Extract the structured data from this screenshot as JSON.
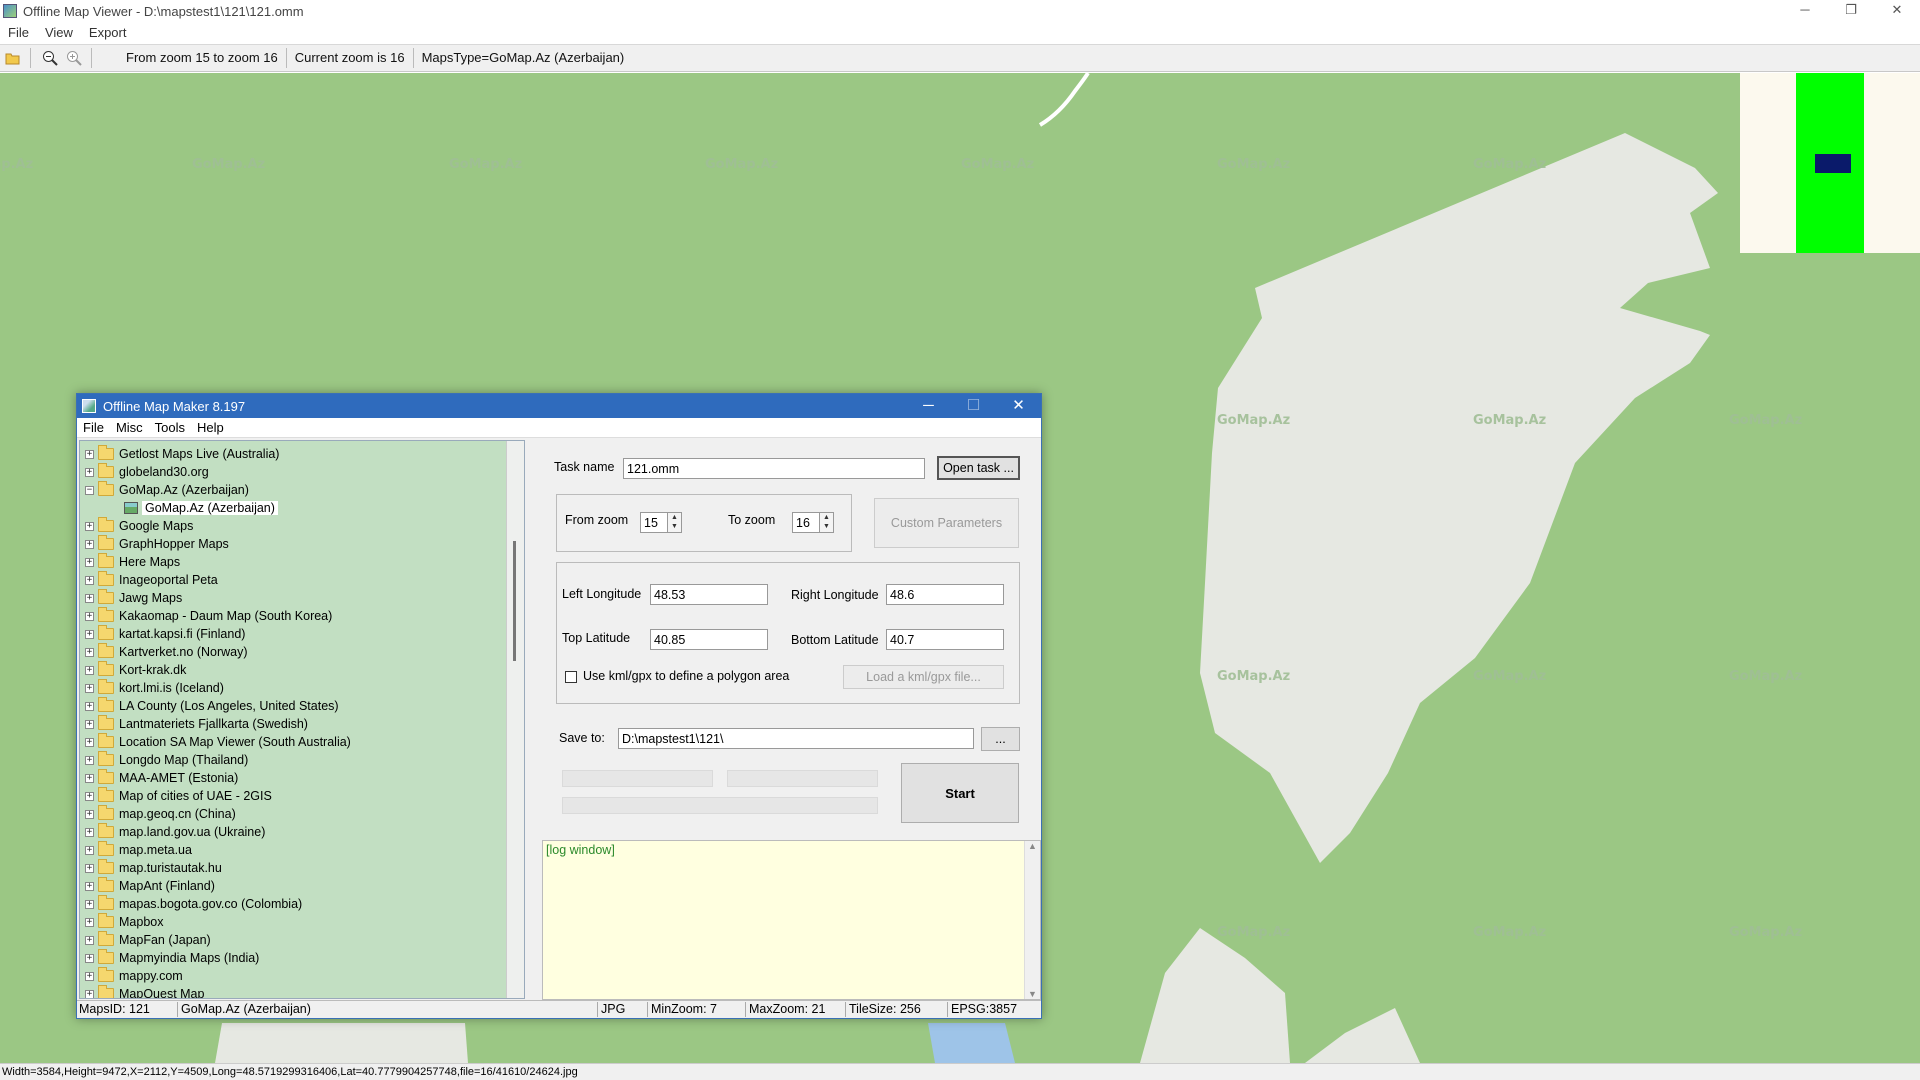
{
  "window": {
    "title": "Offline Map Viewer - D:\\mapstest1\\121\\121.omm",
    "controls": {
      "minimize": "─",
      "maximize": "❐",
      "close": "✕"
    }
  },
  "menu": [
    "File",
    "View",
    "Export"
  ],
  "toolbar": {
    "zoom_range": "From zoom 15 to zoom 16",
    "current_zoom": "Current zoom is 16",
    "maps_type": "MapsType=GoMap.Az (Azerbaijan)"
  },
  "map": {
    "watermark": "GoMap.Az",
    "colors": {
      "land": "#9bc784",
      "area": "#e6e8e2",
      "road": "#ffffff",
      "water": "#9ec4e8",
      "minimap_bg": "#fcf9ee",
      "minimap_green": "#00ff00",
      "minimap_view": "#0a1a6a"
    }
  },
  "status_bar": "Width=3584,Height=9472,X=2112,Y=4509,Long=48.5719299316406,Lat=40.7779904257748,file=16/41610/24624.jpg",
  "dialog": {
    "title": "Offline Map Maker 8.197",
    "controls": {
      "minimize": "─",
      "maximize": "☐",
      "close": "✕"
    },
    "menu": [
      "File",
      "Misc",
      "Tools",
      "Help"
    ],
    "tree": [
      {
        "label": "Getlost Maps Live (Australia)",
        "expanded": false
      },
      {
        "label": "globeland30.org",
        "expanded": false
      },
      {
        "label": "GoMap.Az (Azerbaijan)",
        "expanded": true
      },
      {
        "label": "GoMap.Az (Azerbaijan)",
        "child": true,
        "selected": true
      },
      {
        "label": "Google Maps",
        "expanded": false
      },
      {
        "label": "GraphHopper Maps",
        "expanded": false
      },
      {
        "label": "Here Maps",
        "expanded": false
      },
      {
        "label": "Inageoportal Peta",
        "expanded": false
      },
      {
        "label": "Jawg Maps",
        "expanded": false
      },
      {
        "label": "Kakaomap - Daum Map (South Korea)",
        "expanded": false
      },
      {
        "label": "kartat.kapsi.fi (Finland)",
        "expanded": false
      },
      {
        "label": "Kartverket.no (Norway)",
        "expanded": false
      },
      {
        "label": "Kort-krak.dk",
        "expanded": false
      },
      {
        "label": "kort.lmi.is (Iceland)",
        "expanded": false
      },
      {
        "label": "LA County (Los Angeles, United States)",
        "expanded": false
      },
      {
        "label": "Lantmateriets Fjallkarta (Swedish)",
        "expanded": false
      },
      {
        "label": "Location SA Map Viewer (South Australia)",
        "expanded": false
      },
      {
        "label": "Longdo Map (Thailand)",
        "expanded": false
      },
      {
        "label": "MAA-AMET (Estonia)",
        "expanded": false
      },
      {
        "label": "Map of cities of UAE - 2GIS",
        "expanded": false
      },
      {
        "label": "map.geoq.cn (China)",
        "expanded": false
      },
      {
        "label": "map.land.gov.ua (Ukraine)",
        "expanded": false
      },
      {
        "label": "map.meta.ua",
        "expanded": false
      },
      {
        "label": "map.turistautak.hu",
        "expanded": false
      },
      {
        "label": "MapAnt (Finland)",
        "expanded": false
      },
      {
        "label": "mapas.bogota.gov.co (Colombia)",
        "expanded": false
      },
      {
        "label": "Mapbox",
        "expanded": false
      },
      {
        "label": "MapFan (Japan)",
        "expanded": false
      },
      {
        "label": "Mapmyindia Maps (India)",
        "expanded": false
      },
      {
        "label": "mappy.com",
        "expanded": false
      },
      {
        "label": "MapQuest Map",
        "expanded": false
      }
    ],
    "task": {
      "label": "Task name",
      "value": "121.omm",
      "open_button": "Open task ..."
    },
    "zoom": {
      "from_label": "From zoom",
      "from_value": "15",
      "to_label": "To zoom",
      "to_value": "16",
      "custom_button": "Custom Parameters"
    },
    "coords": {
      "left_lon_label": "Left Longitude",
      "left_lon": "48.53",
      "right_lon_label": "Right Longitude",
      "right_lon": "48.6",
      "top_lat_label": "Top Latitude",
      "top_lat": "40.85",
      "bottom_lat_label": "Bottom Latitude",
      "bottom_lat": "40.7",
      "kml_checkbox_label": "Use kml/gpx to define a polygon area",
      "kml_checked": false,
      "load_kml_button": "Load a kml/gpx file..."
    },
    "save": {
      "label": "Save to:",
      "value": "D:\\mapstest1\\121\\",
      "browse_button": "..."
    },
    "start_button": "Start",
    "log_text": "[log window]",
    "status": {
      "maps_id": "MapsID: 121",
      "maps_name": "GoMap.Az (Azerbaijan)",
      "format": "JPG",
      "min_zoom": "MinZoom: 7",
      "max_zoom": "MaxZoom: 21",
      "tile_size": "TileSize: 256",
      "epsg": "EPSG:3857"
    }
  }
}
